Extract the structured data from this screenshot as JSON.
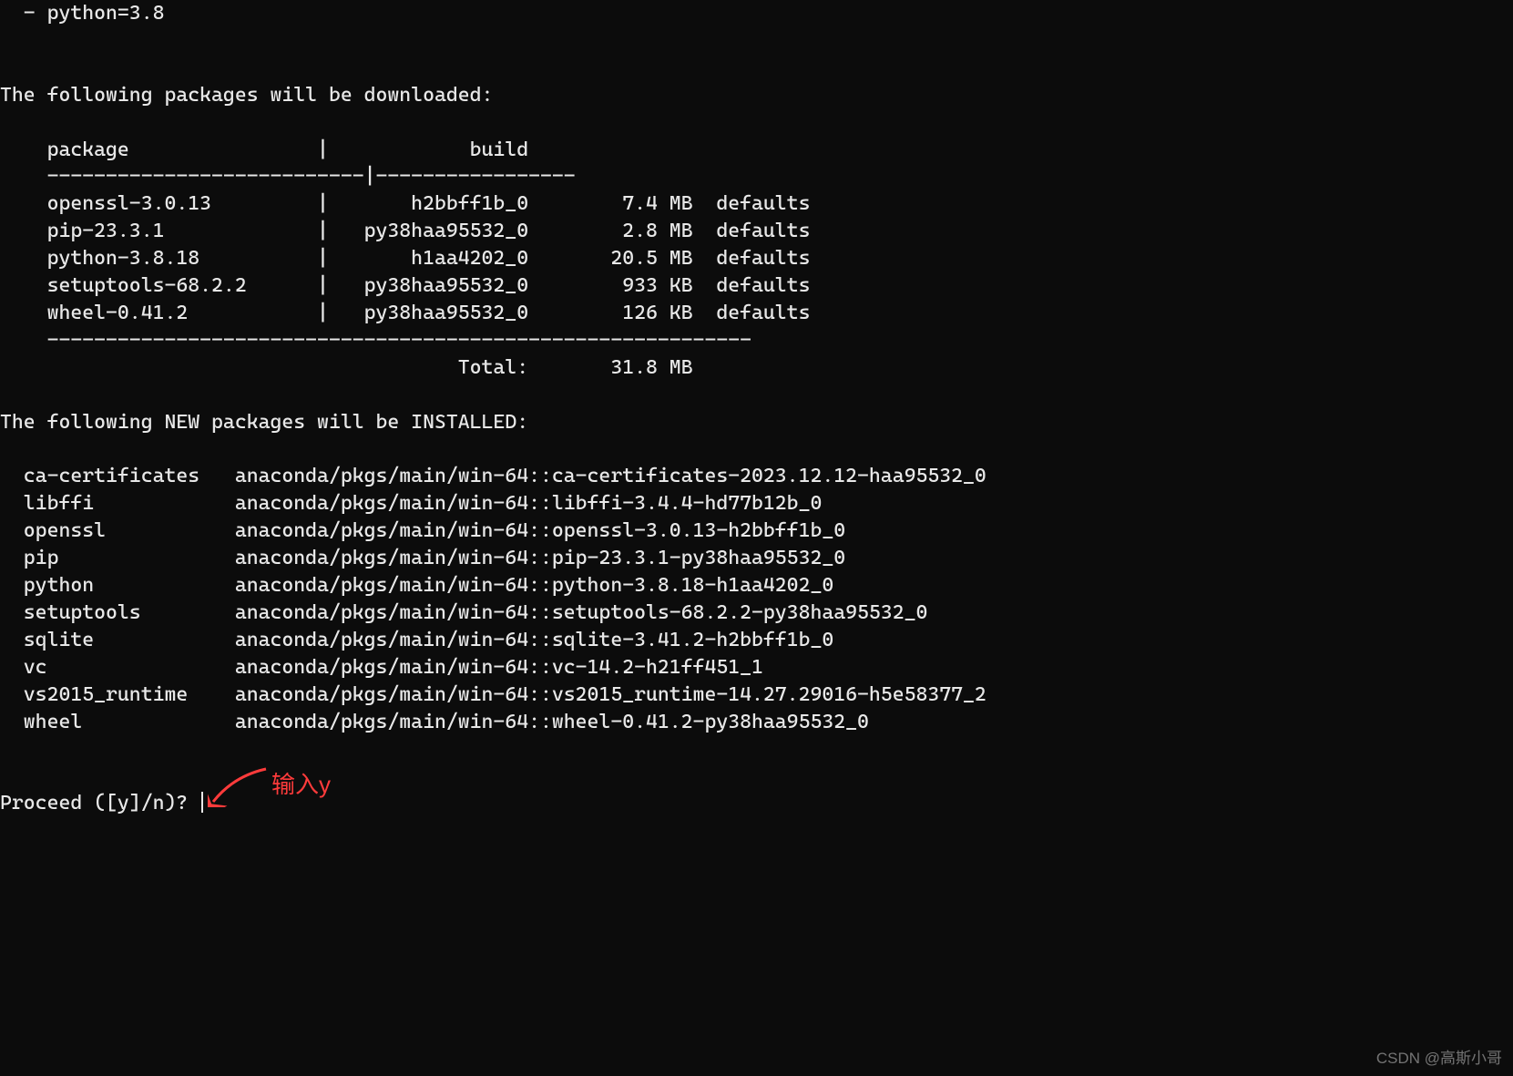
{
  "spec_line": "  - python=3.8",
  "blank": "",
  "download_heading": "The following packages will be downloaded:",
  "dl_table": {
    "hdr_left": "    package",
    "hdr_right": "build",
    "sep_top": "    ---------------------------|-----------------",
    "rows": [
      {
        "pkg": "    openssl-3.0.13",
        "build": "h2bbff1b_0",
        "size": "7.4 MB",
        "channel": "defaults"
      },
      {
        "pkg": "    pip-23.3.1",
        "build": "py38haa95532_0",
        "size": "2.8 MB",
        "channel": "defaults"
      },
      {
        "pkg": "    python-3.8.18",
        "build": "h1aa4202_0",
        "size": "20.5 MB",
        "channel": "defaults"
      },
      {
        "pkg": "    setuptools-68.2.2",
        "build": "py38haa95532_0",
        "size": "933 KB",
        "channel": "defaults"
      },
      {
        "pkg": "    wheel-0.41.2",
        "build": "py38haa95532_0",
        "size": "126 KB",
        "channel": "defaults"
      }
    ],
    "sep_bot": "    ------------------------------------------------------------",
    "total_label": "Total:",
    "total_value": "31.8 MB"
  },
  "install_heading": "The following NEW packages will be INSTALLED:",
  "install_rows": [
    {
      "name": "  ca-certificates",
      "spec": "anaconda/pkgs/main/win-64::ca-certificates-2023.12.12-haa95532_0"
    },
    {
      "name": "  libffi",
      "spec": "anaconda/pkgs/main/win-64::libffi-3.4.4-hd77b12b_0"
    },
    {
      "name": "  openssl",
      "spec": "anaconda/pkgs/main/win-64::openssl-3.0.13-h2bbff1b_0"
    },
    {
      "name": "  pip",
      "spec": "anaconda/pkgs/main/win-64::pip-23.3.1-py38haa95532_0"
    },
    {
      "name": "  python",
      "spec": "anaconda/pkgs/main/win-64::python-3.8.18-h1aa4202_0"
    },
    {
      "name": "  setuptools",
      "spec": "anaconda/pkgs/main/win-64::setuptools-68.2.2-py38haa95532_0"
    },
    {
      "name": "  sqlite",
      "spec": "anaconda/pkgs/main/win-64::sqlite-3.41.2-h2bbff1b_0"
    },
    {
      "name": "  vc",
      "spec": "anaconda/pkgs/main/win-64::vc-14.2-h21ff451_1"
    },
    {
      "name": "  vs2015_runtime",
      "spec": "anaconda/pkgs/main/win-64::vs2015_runtime-14.27.29016-h5e58377_2"
    },
    {
      "name": "  wheel",
      "spec": "anaconda/pkgs/main/win-64::wheel-0.41.2-py38haa95532_0"
    }
  ],
  "prompt": "Proceed ([y]/n)? ",
  "annotation_text": "输入y",
  "watermark": "CSDN @高斯小哥"
}
